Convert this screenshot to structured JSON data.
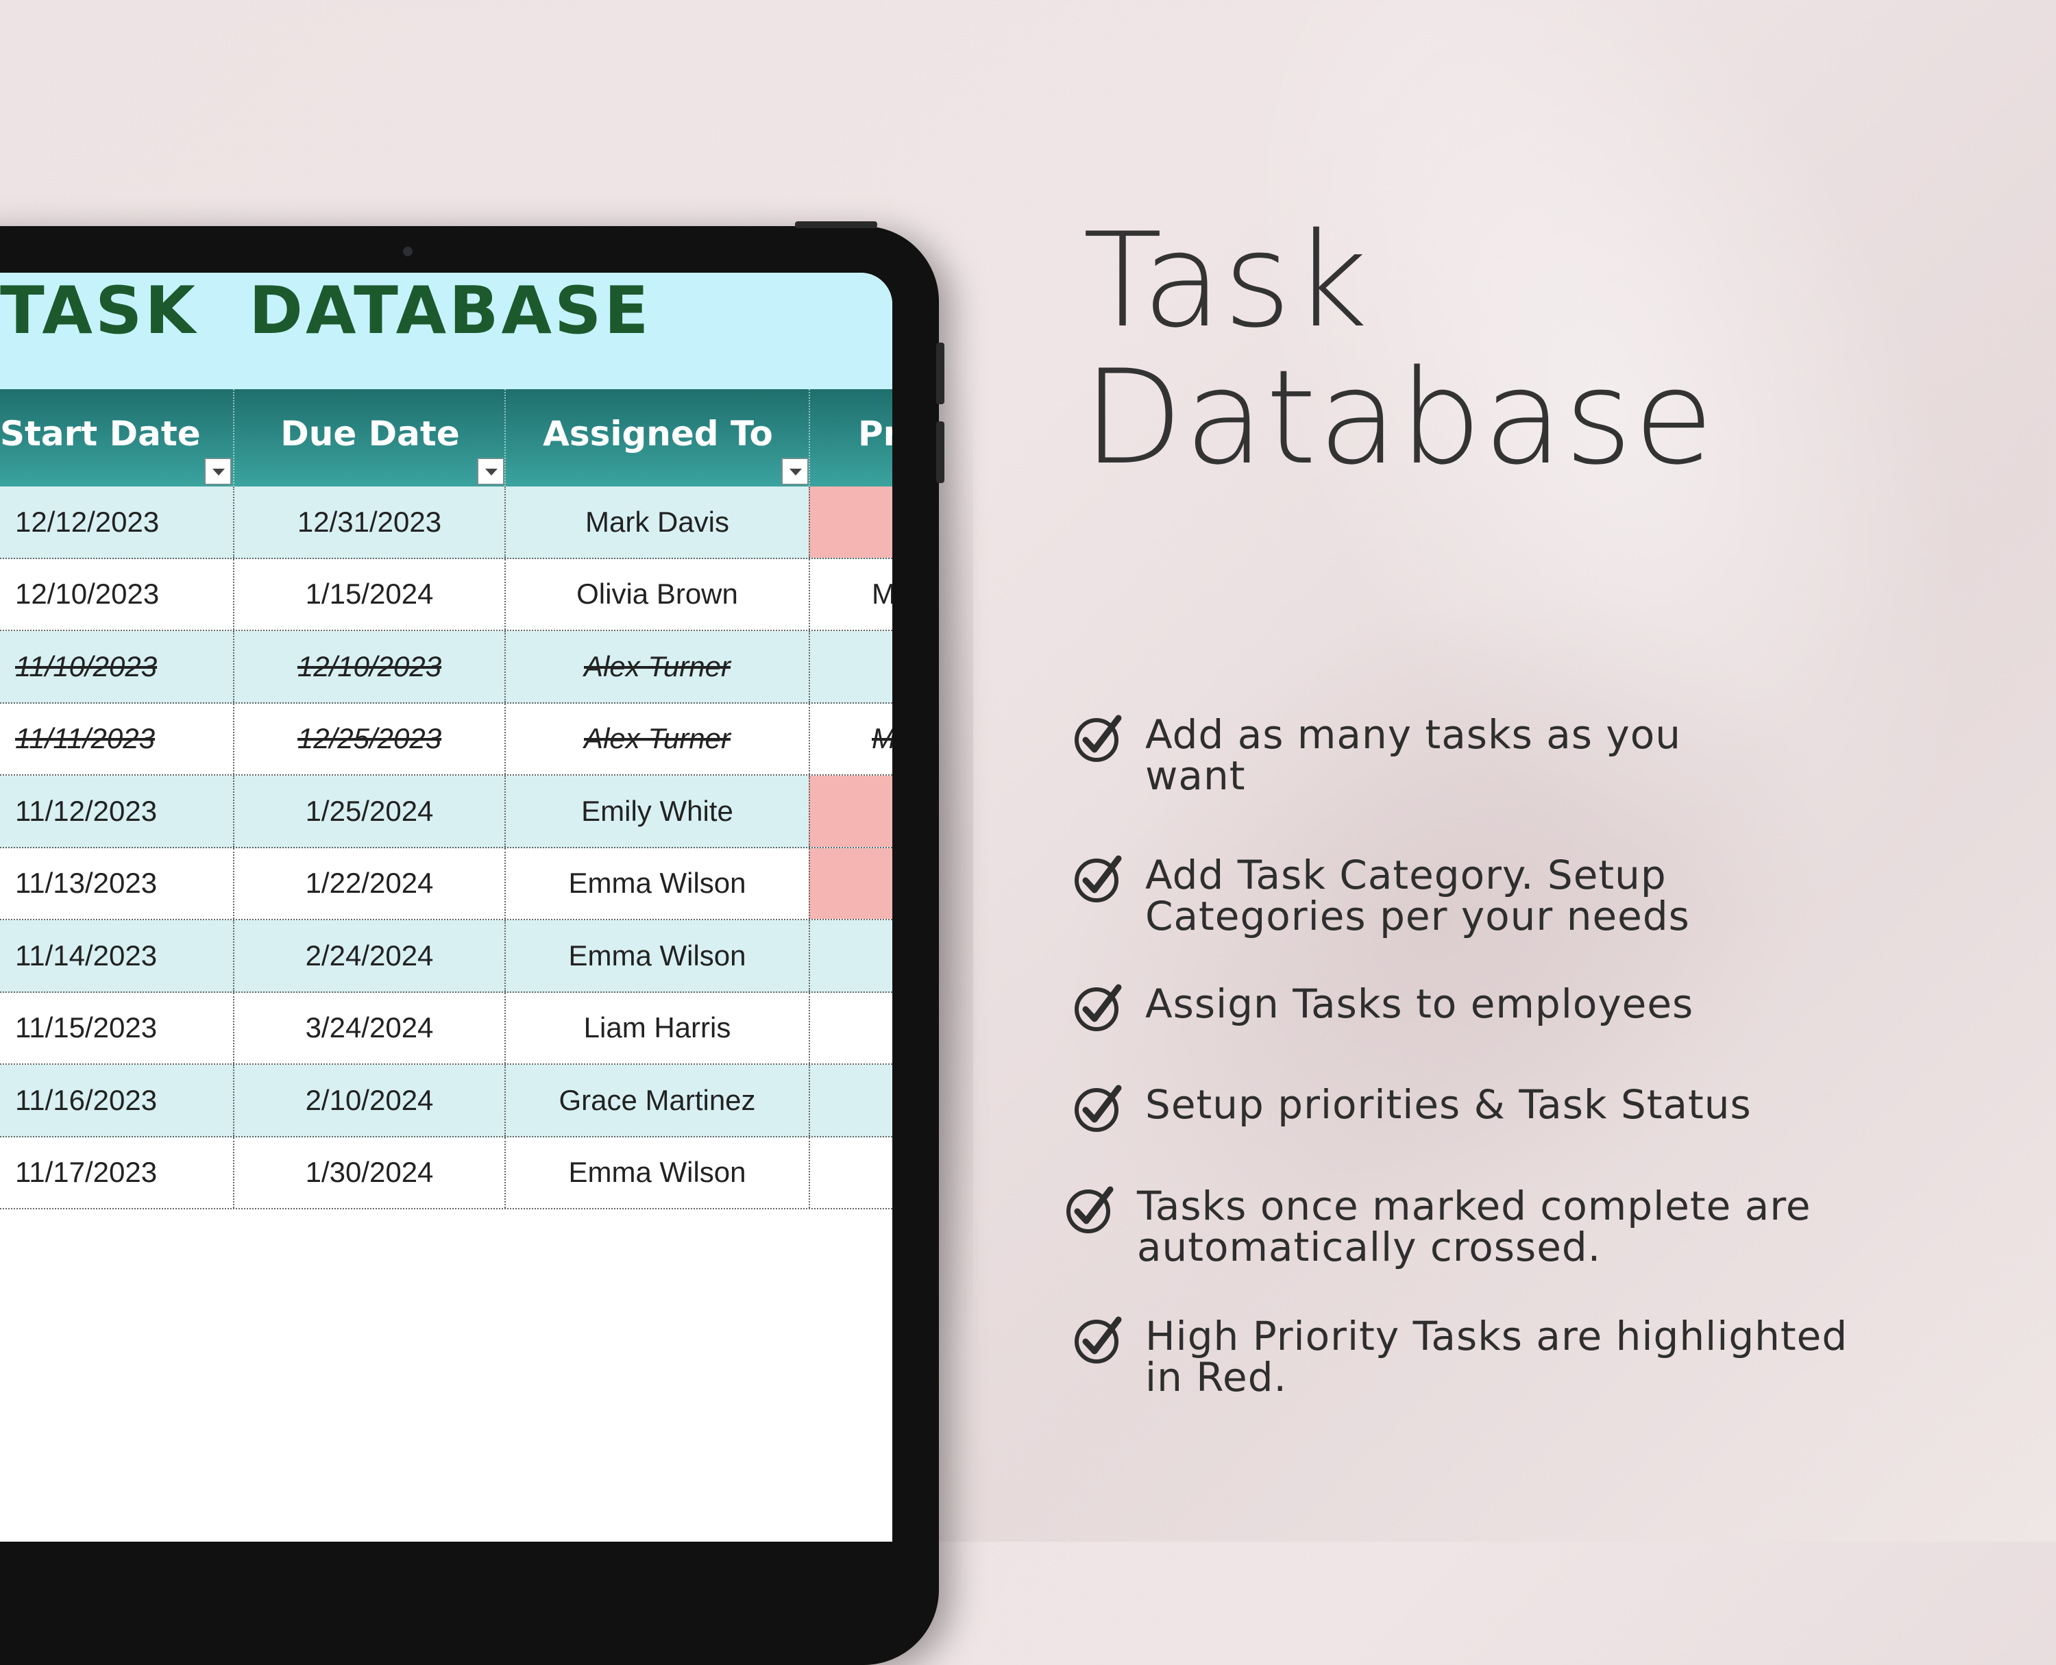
{
  "spreadsheet": {
    "title": "TASK  DATABASE",
    "columns": [
      {
        "label": "Start Date",
        "filter_icon": "dropdown-arrow-icon"
      },
      {
        "label": "Due Date",
        "filter_icon": "dropdown-arrow-icon"
      },
      {
        "label": "Assigned To",
        "filter_icon": "dropdown-arrow-icon"
      },
      {
        "label": "Pr"
      }
    ],
    "rows": [
      {
        "start": "12/12/2023",
        "due": "12/31/2023",
        "assigned": "Mark Davis",
        "priority": "",
        "completed": false,
        "high_priority": true
      },
      {
        "start": "12/10/2023",
        "due": "1/15/2024",
        "assigned": "Olivia Brown",
        "priority": "M",
        "completed": false,
        "high_priority": false
      },
      {
        "start": "11/10/2023",
        "due": "12/10/2023",
        "assigned": "Alex Turner",
        "priority": "",
        "completed": true,
        "high_priority": false
      },
      {
        "start": "11/11/2023",
        "due": "12/25/2023",
        "assigned": "Alex Turner",
        "priority": "M",
        "completed": true,
        "high_priority": false
      },
      {
        "start": "11/12/2023",
        "due": "1/25/2024",
        "assigned": "Emily White",
        "priority": "",
        "completed": false,
        "high_priority": true
      },
      {
        "start": "11/13/2023",
        "due": "1/22/2024",
        "assigned": "Emma Wilson",
        "priority": "",
        "completed": false,
        "high_priority": true
      },
      {
        "start": "11/14/2023",
        "due": "2/24/2024",
        "assigned": "Emma Wilson",
        "priority": "",
        "completed": false,
        "high_priority": false
      },
      {
        "start": "11/15/2023",
        "due": "3/24/2024",
        "assigned": "Liam Harris",
        "priority": "",
        "completed": false,
        "high_priority": false
      },
      {
        "start": "11/16/2023",
        "due": "2/10/2024",
        "assigned": "Grace Martinez",
        "priority": "",
        "completed": false,
        "high_priority": false
      },
      {
        "start": "11/17/2023",
        "due": "1/30/2024",
        "assigned": "Emma Wilson",
        "priority": "",
        "completed": false,
        "high_priority": false
      }
    ]
  },
  "heading": {
    "line1": "Task",
    "line2": "Database"
  },
  "features": [
    {
      "icon": "check-circle-icon",
      "text": "Add as many tasks as you\nwant"
    },
    {
      "icon": "check-circle-icon",
      "text": "Add Task Category. Setup\nCategories per your needs"
    },
    {
      "icon": "check-circle-icon",
      "text": "Assign Tasks to employees"
    },
    {
      "icon": "check-circle-icon",
      "text": "Setup priorities & Task Status"
    },
    {
      "icon": "check-circle-icon",
      "text": "Tasks once marked complete are\nautomatically crossed."
    },
    {
      "icon": "check-circle-icon",
      "text": "High Priority Tasks are highlighted\nin Red."
    }
  ],
  "colors": {
    "background": "#eee3e4",
    "title_band": "#c6f3fb",
    "title_text": "#1c5a2e",
    "header_gradient_top": "#1f6f6d",
    "header_gradient_bottom": "#3ba39e",
    "row_shade": "#d8f0f1",
    "high_priority": "#f5b6b3",
    "text_dark": "#333333"
  }
}
